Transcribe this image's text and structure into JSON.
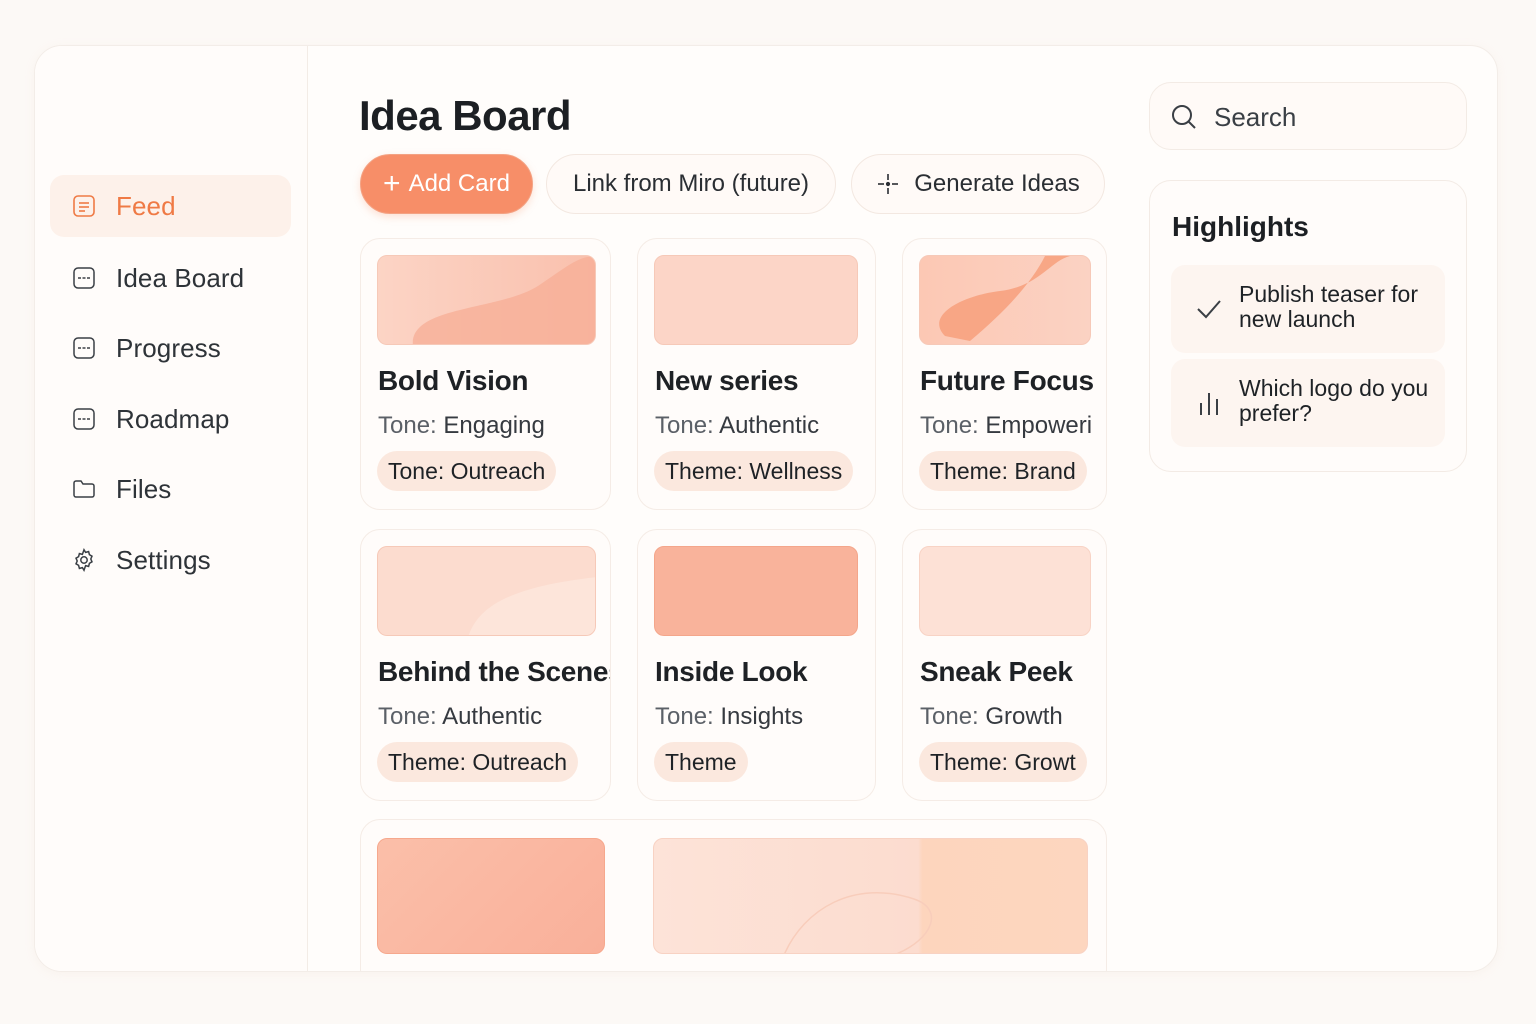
{
  "sidebar": {
    "items": [
      {
        "label": "Feed",
        "icon": "feed-icon",
        "active": true
      },
      {
        "label": "Idea Board",
        "icon": "board-icon",
        "active": false
      },
      {
        "label": "Progress",
        "icon": "progress-icon",
        "active": false
      },
      {
        "label": "Roadmap",
        "icon": "roadmap-icon",
        "active": false
      },
      {
        "label": "Files",
        "icon": "folder-icon",
        "active": false
      },
      {
        "label": "Settings",
        "icon": "gear-icon",
        "active": false
      }
    ]
  },
  "main": {
    "title": "Idea Board",
    "actions": {
      "add_card": "Add Card",
      "link_miro": "Link from Miro (future)",
      "generate": "Generate Ideas"
    },
    "cards": [
      {
        "title": "Bold Vision",
        "tone_key": "Tone:",
        "tone_value": "Engaging",
        "tag_key": "Tone:",
        "tag_value": "Outreach"
      },
      {
        "title": "New series",
        "tone_key": "Tone:",
        "tone_value": "Authentic",
        "tag_key": "Theme:",
        "tag_value": "Wellness"
      },
      {
        "title": "Future Focus",
        "tone_key": "Tone:",
        "tone_value": "Empoweri",
        "tag_key": "Theme:",
        "tag_value": "Brand"
      },
      {
        "title": "Behind the Scenes",
        "tone_key": "Tone:",
        "tone_value": "Authentic",
        "tag_key": "Theme:",
        "tag_value": "Outreach"
      },
      {
        "title": "Inside Look",
        "tone_key": "Tone:",
        "tone_value": "Insights",
        "tag_key": "Theme",
        "tag_value": ""
      },
      {
        "title": "Sneak Peek",
        "tone_key": "Tone:",
        "tone_value": "Growth",
        "tag_key": "Theme:",
        "tag_value": "Growt"
      }
    ]
  },
  "search": {
    "placeholder": "Search"
  },
  "highlights": {
    "title": "Highlights",
    "items": [
      {
        "text": "Publish teaser for new launch",
        "icon": "check-icon"
      },
      {
        "text": "Which logo do you prefer?",
        "icon": "bar-chart-icon"
      }
    ]
  },
  "colors": {
    "accent": "#f78e68",
    "accent_text": "#ef7a45",
    "tag_bg": "#fbe8de",
    "background": "#fcf9f6"
  }
}
